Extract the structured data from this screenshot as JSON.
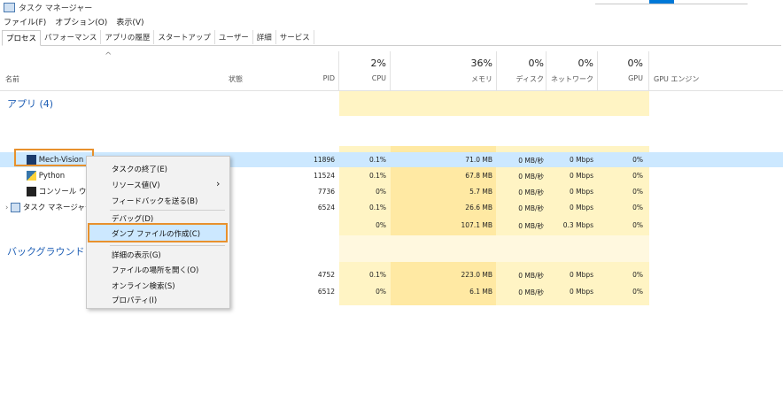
{
  "window": {
    "title": "タスク マネージャー"
  },
  "menu": [
    "ファイル(F)",
    "オプション(O)",
    "表示(V)"
  ],
  "tabs": [
    "プロセス",
    "パフォーマンス",
    "アプリの履歴",
    "スタートアップ",
    "ユーザー",
    "詳細",
    "サービス"
  ],
  "header": {
    "sort_arrow": "^",
    "name": "名前",
    "status": "状態",
    "pid": "PID",
    "cpu_pct": "2%",
    "cpu": "CPU",
    "mem_pct": "36%",
    "mem": "メモリ",
    "disk_pct": "0%",
    "disk": "ディスク",
    "net_pct": "0%",
    "net": "ネットワーク",
    "gpu_pct": "0%",
    "gpu": "GPU",
    "gpu_engine": "GPU エンジン"
  },
  "groups": {
    "apps": "アプリ (4)",
    "background": "バックグラウンド プ"
  },
  "rows": [
    {
      "name": "Mech-Vision",
      "pid": "11896",
      "cpu": "0.1%",
      "mem": "71.0 MB",
      "disk": "0 MB/秒",
      "net": "0 Mbps",
      "gpu": "0%"
    },
    {
      "name": "Python",
      "pid": "11524",
      "cpu": "0.1%",
      "mem": "67.8 MB",
      "disk": "0 MB/秒",
      "net": "0 Mbps",
      "gpu": "0%"
    },
    {
      "name": "コンソール ウイン",
      "pid": "7736",
      "cpu": "0%",
      "mem": "5.7 MB",
      "disk": "0 MB/秒",
      "net": "0 Mbps",
      "gpu": "0%"
    },
    {
      "name": "タスク マネージャー",
      "pid": "6524",
      "cpu": "0.1%",
      "mem": "26.6 MB",
      "disk": "0 MB/秒",
      "net": "0 Mbps",
      "gpu": "0%"
    },
    {
      "name": "",
      "pid": "",
      "cpu": "0%",
      "mem": "107.1 MB",
      "disk": "0 MB/秒",
      "net": "0.3 Mbps",
      "gpu": "0%"
    },
    {
      "name": "",
      "pid": "4752",
      "cpu": "0.1%",
      "mem": "223.0 MB",
      "disk": "0 MB/秒",
      "net": "0 Mbps",
      "gpu": "0%"
    },
    {
      "name": "",
      "pid": "6512",
      "cpu": "0%",
      "mem": "6.1 MB",
      "disk": "0 MB/秒",
      "net": "0 Mbps",
      "gpu": "0%"
    }
  ],
  "context_menu": {
    "end_task": "タスクの終了(E)",
    "resource_values": "リソース値(V)",
    "submenu_arrow": "›",
    "feedback": "フィードバックを送る(B)",
    "debug": "デバッグ(D)",
    "create_dump": "ダンプ ファイルの作成(C)",
    "details": "詳細の表示(G)",
    "open_location": "ファイルの場所を開く(O)",
    "search_online": "オンライン検索(S)",
    "properties": "プロパティ(I)"
  },
  "colors": {
    "accent": "#0078d7",
    "highlight_border": "#e8912d",
    "selection": "#cce8ff",
    "heat_light": "#fff4c4",
    "heat_mid": "#ffe9a3"
  }
}
